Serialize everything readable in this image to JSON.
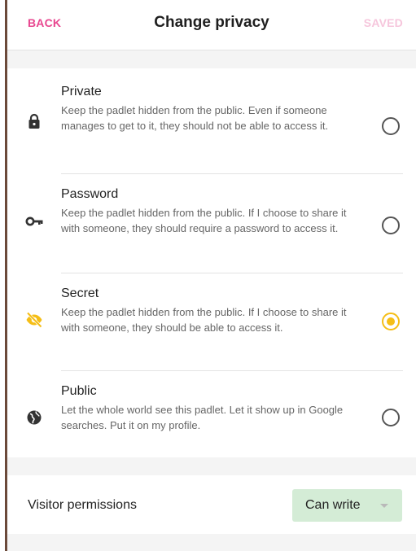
{
  "header": {
    "back_label": "BACK",
    "title": "Change privacy",
    "saved_label": "SAVED"
  },
  "privacy": {
    "selected": "Secret",
    "options": [
      {
        "title": "Private",
        "description": "Keep the padlet hidden from the public. Even if someone manages to get to it, they should not be able to access it.",
        "icon": "lock-icon",
        "checked": false
      },
      {
        "title": "Password",
        "description": "Keep the padlet hidden from the public. If I choose to share it with someone, they should require a password to access it.",
        "icon": "key-icon",
        "checked": false
      },
      {
        "title": "Secret",
        "description": "Keep the padlet hidden from the public. If I choose to share it with someone, they should be able to access it.",
        "icon": "eye-off-icon",
        "checked": true
      },
      {
        "title": "Public",
        "description": "Let the whole world see this padlet. Let it show up in Google searches. Put it on my profile.",
        "icon": "globe-icon",
        "checked": false
      }
    ]
  },
  "permissions": {
    "label": "Visitor permissions",
    "value": "Can write"
  },
  "colors": {
    "accent_pink": "#e8468f",
    "selected_yellow": "#f5be16",
    "select_green": "#d4ecd6"
  }
}
